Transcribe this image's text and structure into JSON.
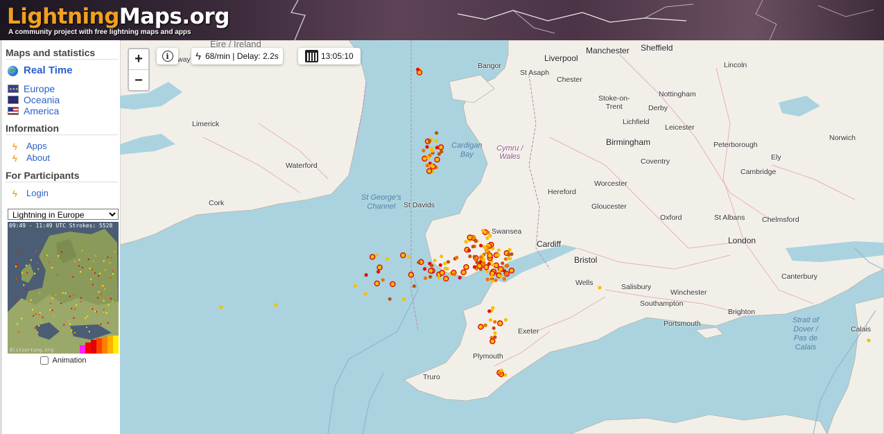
{
  "header": {
    "logo_part1": "Lightning",
    "logo_part2": "Maps.org",
    "tagline": "A community project with free lightning maps and apps"
  },
  "sidebar": {
    "sections": [
      {
        "title": "Maps and statistics"
      },
      {
        "title": "Information"
      },
      {
        "title": "For Participants"
      }
    ],
    "realtime_label": "Real Time",
    "regions": [
      "Europe",
      "Oceania",
      "America"
    ],
    "info_links": [
      "Apps",
      "About"
    ],
    "participant_links": [
      "Login"
    ],
    "minimap": {
      "selected_option": "Lightning in Europe",
      "caption": "09:49 - 11:49 UTC Strokes: 5528",
      "credit": "Blitzortung.org"
    },
    "animation_label": "Animation"
  },
  "map_controls": {
    "zoom_in": "+",
    "zoom_out": "−",
    "info_icon": "info-icon",
    "stats": "68/min | Delay: 2.2s",
    "time": "13:05:10"
  },
  "places": {
    "eire": "Éire / Ireland",
    "galway": "way",
    "limerick": "Limerick",
    "waterford": "Waterford",
    "cork": "Cork",
    "bangor": "Bangor",
    "st_asaph": "St Asaph",
    "liverpool": "Liverpool",
    "chester": "Chester",
    "manchester": "Manchester",
    "sheffield": "Sheffield",
    "lincoln": "Lincoln",
    "stoke": "Stoke-on-\nTrent",
    "nottingham": "Nottingham",
    "derby": "Derby",
    "lichfield": "Lichfield",
    "leicester": "Leicester",
    "norwich": "Norwich",
    "birmingham": "Birmingham",
    "peterborough": "Peterborough",
    "ely": "Ely",
    "coventry": "Coventry",
    "cambridge": "Cambridge",
    "cardigan_bay": "Cardigan\nBay",
    "cymru": "Cymru /\nWales",
    "st_georges": "St George's\nChannel",
    "st_davids": "St Davids",
    "hereford": "Hereford",
    "worcester": "Worcester",
    "gloucester": "Gloucester",
    "oxford": "Oxford",
    "st_albans": "St Albans",
    "chelmsford": "Chelmsford",
    "swansea": "Swansea",
    "cardiff": "Cardiff",
    "london": "London",
    "bristol": "Bristol",
    "canterbury": "Canterbury",
    "wells": "Wells",
    "salisbury": "Salisbury",
    "winchester": "Winchester",
    "southampton": "Southampton",
    "brighton": "Brighton",
    "exeter": "Exeter",
    "portsmouth": "Portsmouth",
    "strait": "Strait of\nDover /\nPas de\nCalais",
    "calais": "Calais",
    "plymouth": "Plymouth",
    "truro": "Truro"
  },
  "colors": {
    "strike_recent": "#e01010",
    "strike_mid": "#f07000",
    "strike_old": "#f5c000",
    "strike_oldest": "#c05010",
    "sea": "#aad3df",
    "land": "#f2efe9"
  }
}
